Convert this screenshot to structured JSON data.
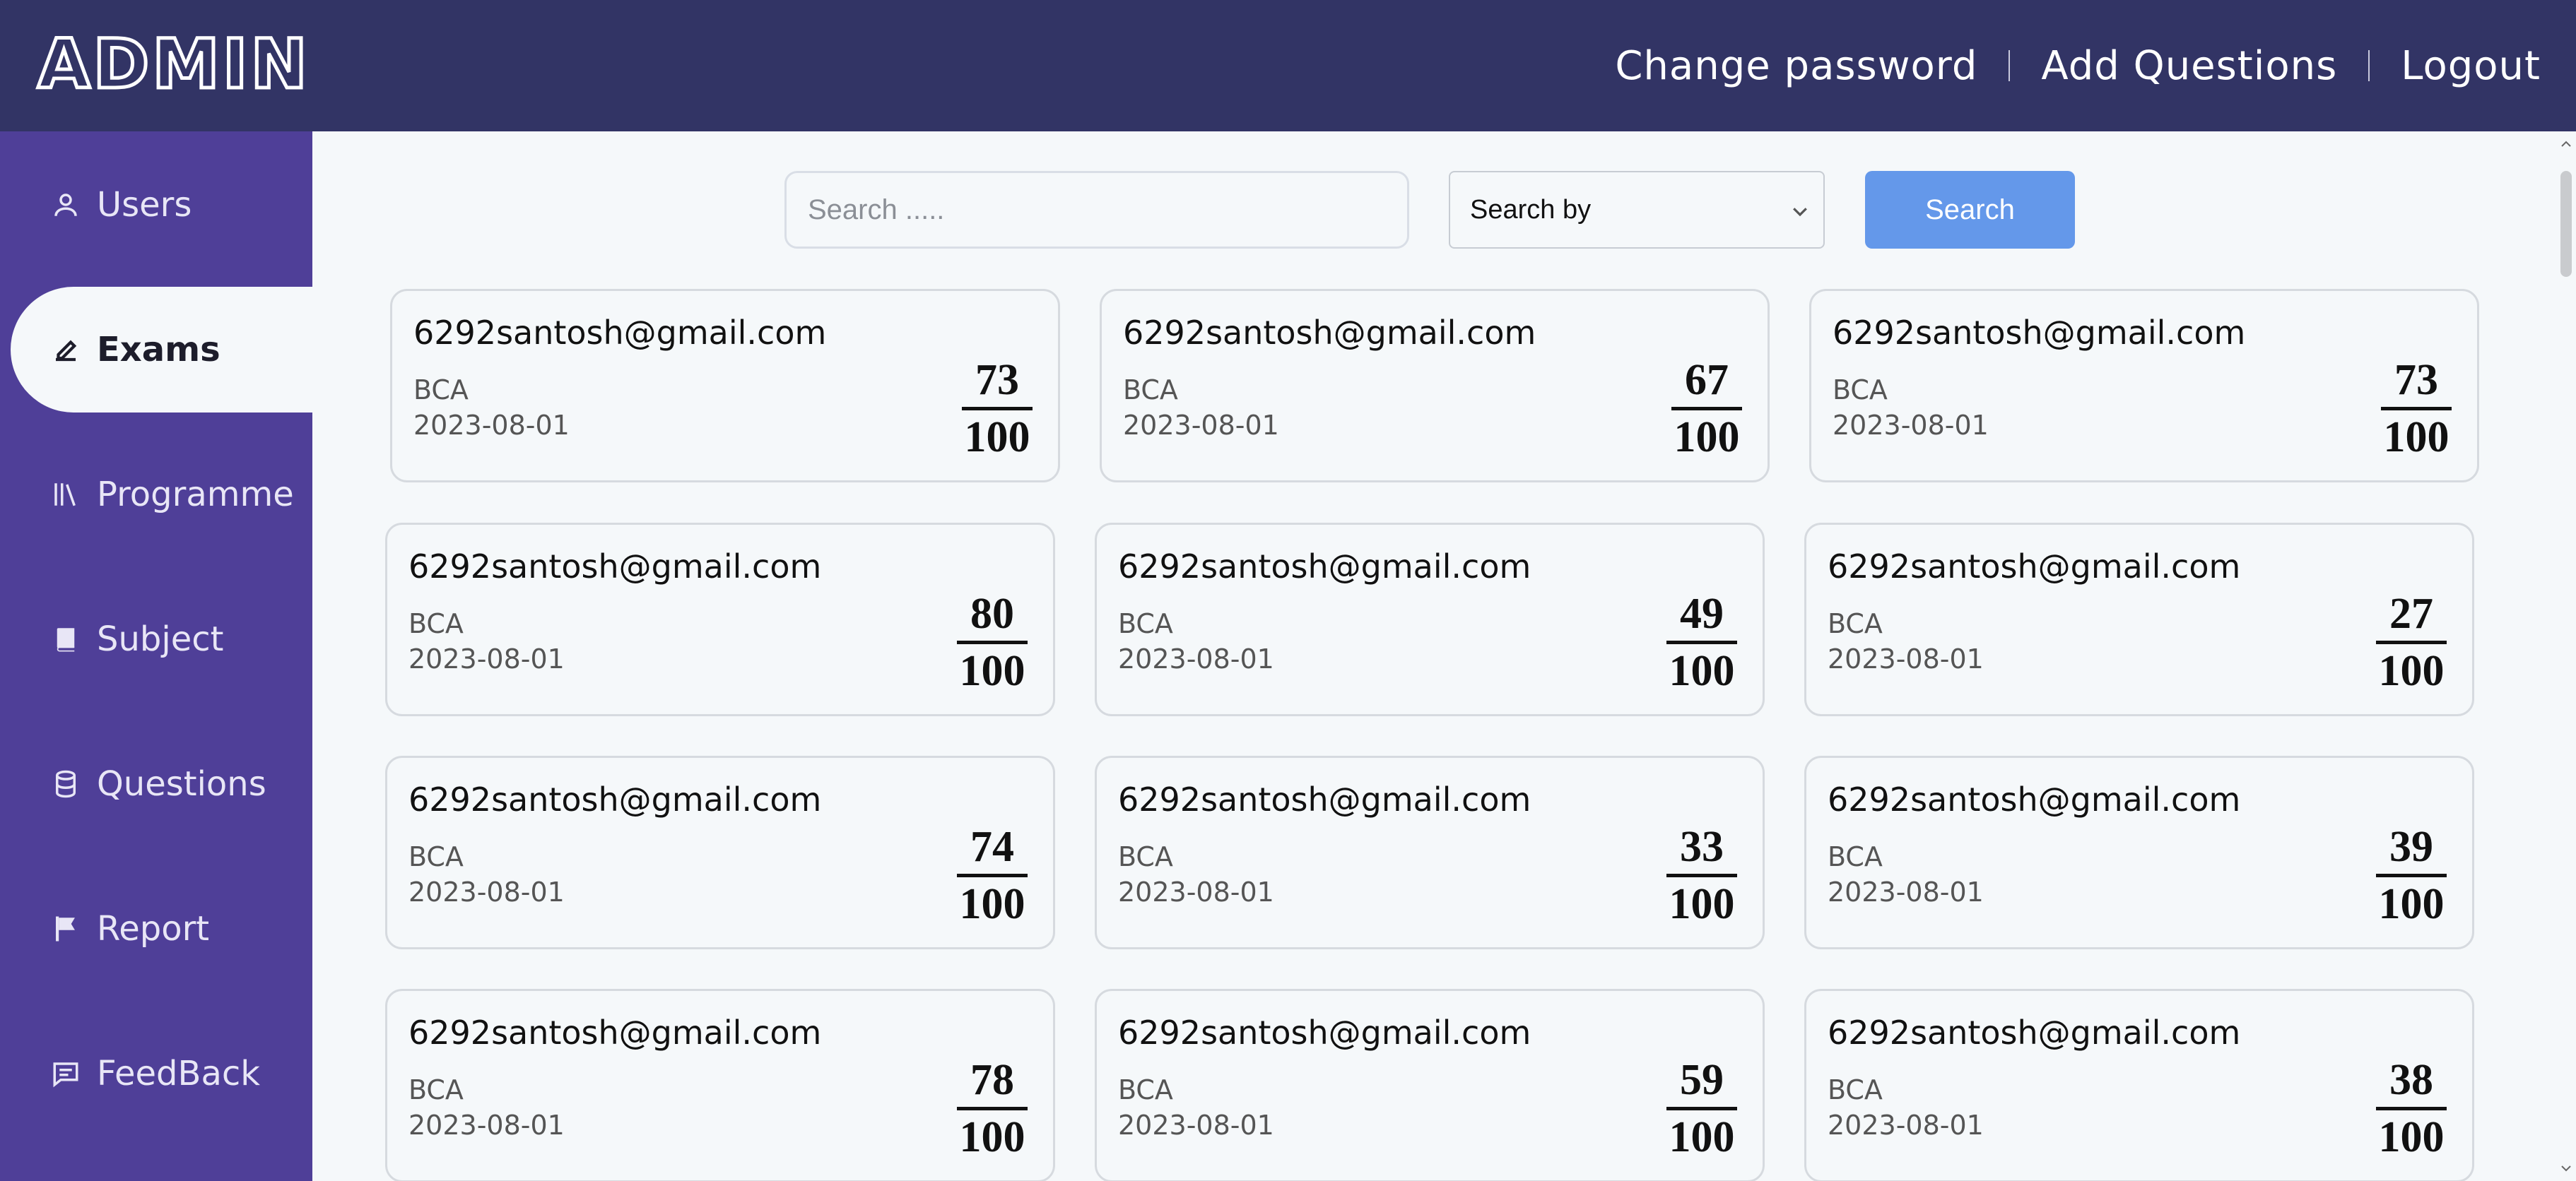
{
  "header": {
    "logo_text": "ADMIN",
    "nav": [
      {
        "label": "Change password"
      },
      {
        "label": "Add Questions"
      },
      {
        "label": "Logout"
      }
    ]
  },
  "sidebar": {
    "items": [
      {
        "label": "Users",
        "icon": "user-icon",
        "active": false
      },
      {
        "label": "Exams",
        "icon": "pencil-icon",
        "active": true
      },
      {
        "label": "Programme",
        "icon": "library-icon",
        "active": false
      },
      {
        "label": "Subject",
        "icon": "book-icon",
        "active": false
      },
      {
        "label": "Questions",
        "icon": "database-icon",
        "active": false
      },
      {
        "label": "Report",
        "icon": "flag-icon",
        "active": false
      },
      {
        "label": "FeedBack",
        "icon": "chat-icon",
        "active": false
      }
    ]
  },
  "search": {
    "placeholder": "Search .....",
    "select_value": "Search by",
    "button_label": "Search"
  },
  "colors": {
    "header_bg": "#323465",
    "sidebar_bg": "#4f3f98",
    "accent": "#6498ea",
    "page_bg": "#f5f8fa"
  },
  "results": [
    {
      "email": "6292santosh@gmail.com",
      "programme": "BCA",
      "date": "2023-08-01",
      "score": "73",
      "total": "100"
    },
    {
      "email": "6292santosh@gmail.com",
      "programme": "BCA",
      "date": "2023-08-01",
      "score": "67",
      "total": "100"
    },
    {
      "email": "6292santosh@gmail.com",
      "programme": "BCA",
      "date": "2023-08-01",
      "score": "73",
      "total": "100"
    },
    {
      "email": "6292santosh@gmail.com",
      "programme": "BCA",
      "date": "2023-08-01",
      "score": "80",
      "total": "100"
    },
    {
      "email": "6292santosh@gmail.com",
      "programme": "BCA",
      "date": "2023-08-01",
      "score": "49",
      "total": "100"
    },
    {
      "email": "6292santosh@gmail.com",
      "programme": "BCA",
      "date": "2023-08-01",
      "score": "27",
      "total": "100"
    },
    {
      "email": "6292santosh@gmail.com",
      "programme": "BCA",
      "date": "2023-08-01",
      "score": "74",
      "total": "100"
    },
    {
      "email": "6292santosh@gmail.com",
      "programme": "BCA",
      "date": "2023-08-01",
      "score": "33",
      "total": "100"
    },
    {
      "email": "6292santosh@gmail.com",
      "programme": "BCA",
      "date": "2023-08-01",
      "score": "39",
      "total": "100"
    },
    {
      "email": "6292santosh@gmail.com",
      "programme": "BCA",
      "date": "2023-08-01",
      "score": "78",
      "total": "100"
    },
    {
      "email": "6292santosh@gmail.com",
      "programme": "BCA",
      "date": "2023-08-01",
      "score": "59",
      "total": "100"
    },
    {
      "email": "6292santosh@gmail.com",
      "programme": "BCA",
      "date": "2023-08-01",
      "score": "38",
      "total": "100"
    }
  ]
}
